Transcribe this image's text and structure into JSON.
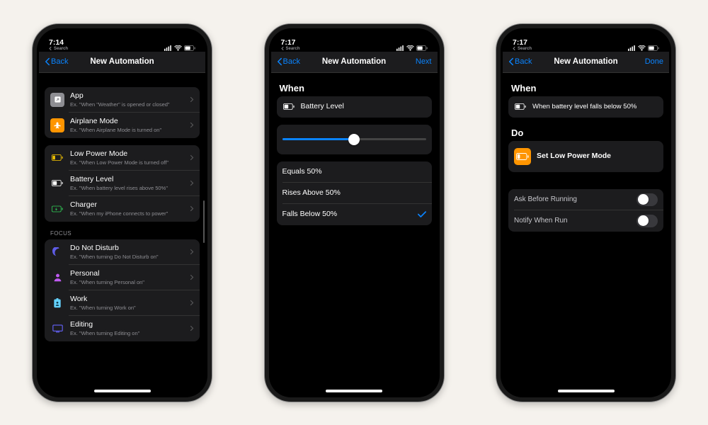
{
  "status": {
    "time1": "7:14",
    "time2": "7:17",
    "time3": "7:17",
    "search_label": "Search"
  },
  "nav": {
    "back": "Back",
    "title": "New Automation",
    "next": "Next",
    "done": "Done"
  },
  "phone1": {
    "items_a": [
      {
        "title": "App",
        "sub": "Ex. \"When \"Weather\" is opened or closed\""
      },
      {
        "title": "Airplane Mode",
        "sub": "Ex. \"When Airplane Mode is turned on\""
      }
    ],
    "items_b": [
      {
        "title": "Low Power Mode",
        "sub": "Ex. \"When Low Power Mode is turned off\""
      },
      {
        "title": "Battery Level",
        "sub": "Ex. \"When battery level rises above 50%\""
      },
      {
        "title": "Charger",
        "sub": "Ex. \"When my iPhone connects to power\""
      }
    ],
    "focus_header": "FOCUS",
    "items_c": [
      {
        "title": "Do Not Disturb",
        "sub": "Ex. \"When turning Do Not Disturb on\""
      },
      {
        "title": "Personal",
        "sub": "Ex. \"When turning Personal on\""
      },
      {
        "title": "Work",
        "sub": "Ex. \"When turning Work on\""
      },
      {
        "title": "Editing",
        "sub": "Ex. \"When turning Editing on\""
      }
    ]
  },
  "phone2": {
    "when": "When",
    "battery_level": "Battery Level",
    "slider_pct": 50,
    "options": [
      {
        "label": "Equals 50%",
        "selected": false
      },
      {
        "label": "Rises Above 50%",
        "selected": false
      },
      {
        "label": "Falls Below 50%",
        "selected": true
      }
    ]
  },
  "phone3": {
    "when_header": "When",
    "when_summary": "When battery level falls below 50%",
    "do_header": "Do",
    "action_label": "Set Low Power Mode",
    "toggles": [
      {
        "label": "Ask Before Running",
        "on": false
      },
      {
        "label": "Notify When Run",
        "on": false
      }
    ]
  },
  "icons": {
    "app": {
      "bg": "#8e8e93"
    },
    "airplane": {
      "bg": "#ff9500"
    },
    "lowpower": {
      "bg": "#1c1c1e"
    },
    "battery": {
      "bg": "#1c1c1e"
    },
    "charger": {
      "bg": "#1c1c1e"
    },
    "dnd": {
      "bg": "#5e5ce6"
    },
    "personal": {
      "bg": "#bf5af2"
    },
    "work": {
      "bg": "#64d2ff"
    },
    "editing": {
      "bg": "#5e5ce6"
    },
    "action_lowpower": {
      "bg": "#ff9500"
    }
  }
}
